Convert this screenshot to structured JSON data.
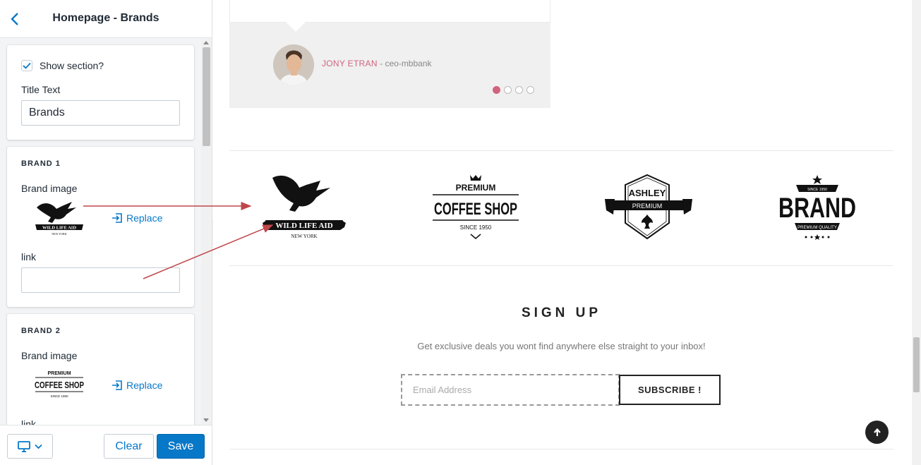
{
  "panel": {
    "title": "Homepage - Brands",
    "section": {
      "show_label": "Show section?",
      "show_checked": true,
      "title_label": "Title Text",
      "title_value": "Brands"
    },
    "brands": [
      {
        "heading": "BRAND 1",
        "image_label": "Brand image",
        "replace_label": "Replace",
        "link_label": "link",
        "link_value": "",
        "image": "wild-life-aid-logo"
      },
      {
        "heading": "BRAND 2",
        "image_label": "Brand image",
        "replace_label": "Replace",
        "link_label": "link",
        "image": "premium-coffee-shop-logo"
      }
    ],
    "footer": {
      "device_icon": "desktop-icon",
      "clear_label": "Clear",
      "save_label": "Save"
    }
  },
  "preview": {
    "testimonial": {
      "author_name": "JONY ETRAN",
      "author_separator": " - ",
      "author_role": "ceo-mbbank",
      "dots_count": 4,
      "active_dot": 1
    },
    "brands": [
      {
        "name": "wild-life-aid-logo",
        "line1": "WILD LIFE AID",
        "line2": "NEW YORK"
      },
      {
        "name": "premium-coffee-shop-logo",
        "line1": "PREMIUM",
        "line2": "COFFEE SHOP",
        "line3": "SINCE 1950"
      },
      {
        "name": "ashley-premium-logo",
        "line1": "ASHLEY",
        "line2": "PREMIUM"
      },
      {
        "name": "brand-premium-quality-logo",
        "line1": "BRAND",
        "line2": "PREMIUM QUALITY",
        "line3": "SINCE 1950"
      }
    ],
    "signup": {
      "title": "SIGN UP",
      "subtitle": "Get exclusive deals you wont find anywhere else straight to your inbox!",
      "email_placeholder": "Email Address",
      "subscribe_label": "SUBSCRIBE !"
    }
  },
  "colors": {
    "accent": "#0778c8",
    "pink": "#d0637e",
    "annotation": "#c0464a"
  }
}
